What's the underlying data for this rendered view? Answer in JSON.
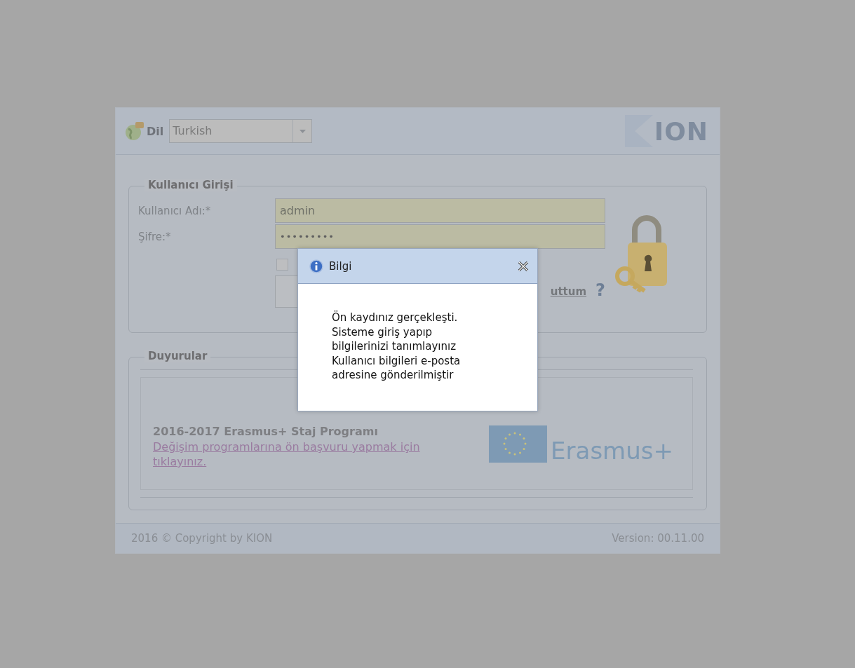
{
  "header": {
    "language_label": "Dil",
    "language": "Turkish",
    "logo_text": "ION"
  },
  "login": {
    "legend": "Kullanıcı Girişi",
    "fields": [
      {
        "label": "Kullanıcı Adı:*",
        "value": "admin",
        "kind": "text"
      },
      {
        "label": "Şifre:*",
        "value": "•••••••••",
        "kind": "password"
      }
    ],
    "remember_checked": false,
    "forgot_link": "uttum",
    "help_glyph": "?"
  },
  "announcements": {
    "legend": "Duyurular",
    "items": [
      {
        "title": "2016-2017 Erasmus+ Staj Programı",
        "link": "Değişim programlarına ön başvuru yapmak için tıklayınız.",
        "logo_text": "Erasmus+"
      }
    ]
  },
  "footer": {
    "copyright": "2016 © Copyright by KION",
    "version": "Version: 00.11.00"
  },
  "dialog": {
    "title": "Bilgi",
    "lines": [
      "Ön kaydınız gerçekleşti.",
      "Sisteme giriş yapıp",
      "bilgilerinizi tanımlayınız",
      "Kullanıcı bilgileri e-posta",
      "adresine gönderilmiştir"
    ]
  }
}
